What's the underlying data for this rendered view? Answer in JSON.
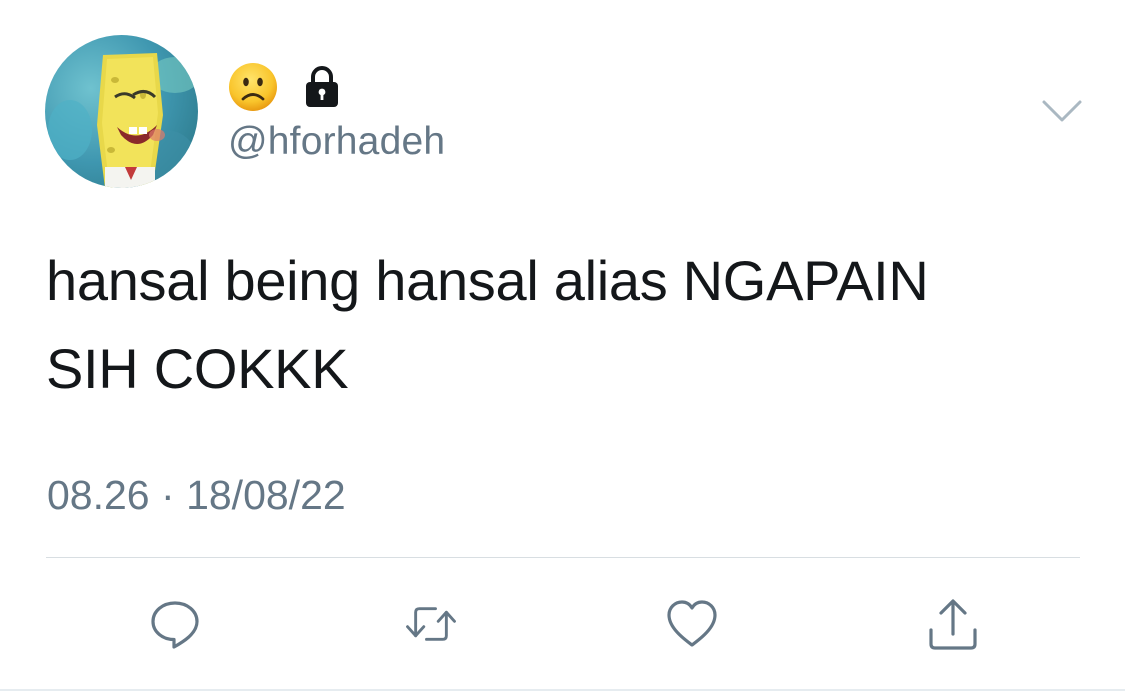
{
  "tweet": {
    "handle": "@hforhadeh",
    "display_name_icons": [
      "frowning-face-emoji",
      "lock-icon"
    ],
    "text": "hansal being hansal alias NGAPAIN\nSIH COKKK",
    "time": "08.26",
    "separator": "·",
    "date": "18/08/22"
  },
  "actions": [
    {
      "name": "reply",
      "icon": "speech-bubble-icon"
    },
    {
      "name": "retweet",
      "icon": "retweet-arrows-icon"
    },
    {
      "name": "like",
      "icon": "heart-icon"
    },
    {
      "name": "share",
      "icon": "share-upload-icon"
    }
  ],
  "colors": {
    "text_primary": "#14171a",
    "text_secondary": "#657786",
    "icon": "#657786",
    "divider": "#d8dee2"
  }
}
